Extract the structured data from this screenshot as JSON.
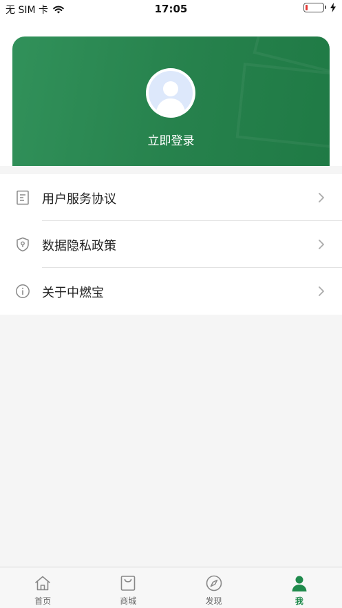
{
  "status_bar": {
    "carrier": "无 SIM 卡",
    "time": "17:05",
    "battery_level": 0.12
  },
  "profile": {
    "login_text": "立即登录"
  },
  "menu": {
    "items": [
      {
        "label": "用户服务协议",
        "icon": "document-icon"
      },
      {
        "label": "数据隐私政策",
        "icon": "shield-lock-icon"
      },
      {
        "label": "关于中燃宝",
        "icon": "info-icon"
      }
    ]
  },
  "tabbar": {
    "tabs": [
      {
        "label": "首页",
        "icon": "home-icon"
      },
      {
        "label": "商城",
        "icon": "shopping-bag-icon"
      },
      {
        "label": "发现",
        "icon": "compass-icon"
      },
      {
        "label": "我",
        "icon": "person-icon"
      }
    ],
    "active_index": 3
  },
  "colors": {
    "brand_green": "#1f8a4c",
    "card_green": "#26814c",
    "battery_low": "#e53935"
  }
}
